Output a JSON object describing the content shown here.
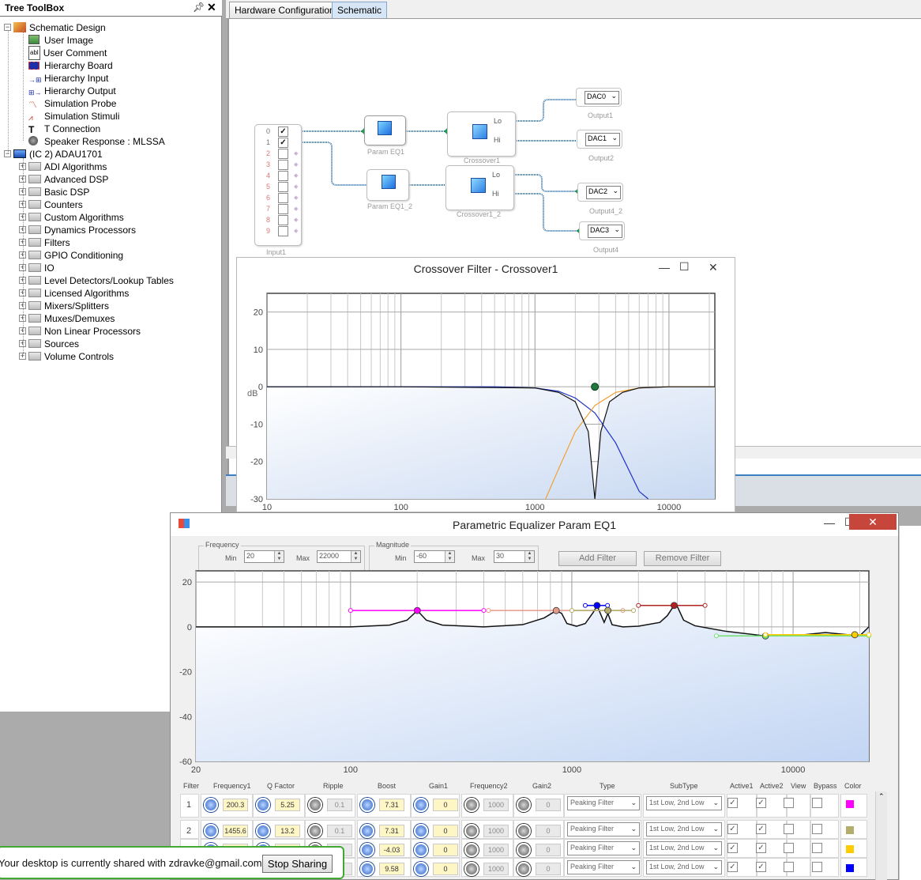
{
  "tree": {
    "title": "Tree ToolBox",
    "items": [
      {
        "label": "Schematic Design",
        "level": 0,
        "expanded": true,
        "icon": "schematic-icon"
      },
      {
        "label": "User Image",
        "level": 1,
        "icon": "image-icon"
      },
      {
        "label": "User Comment",
        "level": 1,
        "icon": "text-icon",
        "glyph": "abl"
      },
      {
        "label": "Hierarchy Board",
        "level": 1,
        "icon": "board-icon"
      },
      {
        "label": "Hierarchy Input",
        "level": 1,
        "icon": "input-icon"
      },
      {
        "label": "Hierarchy Output",
        "level": 1,
        "icon": "output-icon"
      },
      {
        "label": "Simulation Probe",
        "level": 1,
        "icon": "probe-icon"
      },
      {
        "label": "Simulation Stimuli",
        "level": 1,
        "icon": "stimuli-icon"
      },
      {
        "label": "T Connection",
        "level": 1,
        "icon": "t-connection-icon"
      },
      {
        "label": "Speaker Response : MLSSA",
        "level": 1,
        "icon": "speaker-icon"
      },
      {
        "label": "(IC 2) ADAU1701",
        "level": 0,
        "expanded": true,
        "icon": "chip-icon"
      },
      {
        "label": "ADI Algorithms",
        "level": 1,
        "icon": "folder-icon"
      },
      {
        "label": "Advanced DSP",
        "level": 1,
        "icon": "folder-icon"
      },
      {
        "label": "Basic DSP",
        "level": 1,
        "icon": "folder-icon"
      },
      {
        "label": "Counters",
        "level": 1,
        "icon": "folder-icon"
      },
      {
        "label": "Custom Algorithms",
        "level": 1,
        "icon": "folder-icon"
      },
      {
        "label": "Dynamics Processors",
        "level": 1,
        "icon": "folder-icon"
      },
      {
        "label": "Filters",
        "level": 1,
        "icon": "folder-icon"
      },
      {
        "label": "GPIO Conditioning",
        "level": 1,
        "icon": "folder-icon"
      },
      {
        "label": "IO",
        "level": 1,
        "icon": "folder-icon"
      },
      {
        "label": "Level Detectors/Lookup Tables",
        "level": 1,
        "icon": "folder-icon"
      },
      {
        "label": "Licensed Algorithms",
        "level": 1,
        "icon": "folder-icon"
      },
      {
        "label": "Mixers/Splitters",
        "level": 1,
        "icon": "folder-icon"
      },
      {
        "label": "Muxes/Demuxes",
        "level": 1,
        "icon": "folder-icon"
      },
      {
        "label": "Non Linear Processors",
        "level": 1,
        "icon": "folder-icon"
      },
      {
        "label": "Sources",
        "level": 1,
        "icon": "folder-icon"
      },
      {
        "label": "Volume Controls",
        "level": 1,
        "icon": "folder-icon"
      }
    ]
  },
  "tabs": [
    {
      "label": "Hardware Configuration",
      "active": false
    },
    {
      "label": "Schematic",
      "active": true
    }
  ],
  "schematic": {
    "input_label": "Input1",
    "input_channels": [
      "0",
      "1",
      "2",
      "3",
      "4",
      "5",
      "6",
      "7",
      "8",
      "9"
    ],
    "input_checked": [
      true,
      true,
      false,
      false,
      false,
      false,
      false,
      false,
      false,
      false
    ],
    "blocks": {
      "eq1": "Param EQ1",
      "eq1_2": "Param EQ1_2",
      "xo1": "Crossover1",
      "xo1_2": "Crossover1_2",
      "lo": "Lo",
      "hi": "Hi"
    },
    "outputs": [
      {
        "dac": "DAC0",
        "label": "Output1"
      },
      {
        "dac": "DAC1",
        "label": "Output2"
      },
      {
        "dac": "DAC2",
        "label": "Output4_2"
      },
      {
        "dac": "DAC3",
        "label": "Output4"
      }
    ]
  },
  "crossover_window": {
    "title": "Crossover Filter - Crossover1",
    "minimize": "—",
    "maximize": "☐",
    "close": "✕"
  },
  "eq_window": {
    "title": "Parametric Equalizer Param EQ1",
    "minimize": "—",
    "maximize": "☐",
    "close": "✕",
    "frequency_group": {
      "legend": "Frequency",
      "min_label": "Min",
      "min": "20",
      "max_label": "Max",
      "max": "22000"
    },
    "magnitude_group": {
      "legend": "Magnitude",
      "min_label": "Min",
      "min": "-60",
      "max_label": "Max",
      "max": "30"
    },
    "add_filter": "Add Filter",
    "remove_filter": "Remove Filter",
    "table": {
      "headers": [
        "Filter",
        "Frequency1",
        "Q Factor",
        "Ripple",
        "Boost",
        "Gain1",
        "Frequency2",
        "Gain2",
        "Type",
        "SubType",
        "Active1",
        "Active2",
        "View",
        "Bypass",
        "Color"
      ],
      "rows": [
        {
          "filter": "1",
          "frequency1": "200.3",
          "q": "5.25",
          "ripple": "0.1",
          "boost": "7.31",
          "gain1": "0",
          "frequency2": "1000",
          "gain2": "0",
          "type": "Peaking Filter",
          "subtype": "1st Low, 2nd Low",
          "active1": true,
          "active2": true,
          "view": false,
          "bypass": false,
          "color": "#ff00ff"
        },
        {
          "filter": "2",
          "frequency1": "1455.6",
          "q": "13.2",
          "ripple": "0.1",
          "boost": "7.31",
          "gain1": "0",
          "frequency2": "1000",
          "gain2": "0",
          "type": "Peaking Filter",
          "subtype": "1st Low, 2nd Low",
          "active1": true,
          "active2": true,
          "view": false,
          "bypass": false,
          "color": "#b5ad6b"
        },
        {
          "filter": "",
          "frequency1": "",
          "q": "",
          "ripple": "",
          "boost": "-4.03",
          "gain1": "0",
          "frequency2": "1000",
          "gain2": "0",
          "type": "Peaking Filter",
          "subtype": "1st Low, 2nd Low",
          "active1": true,
          "active2": true,
          "view": false,
          "bypass": false,
          "color": "#ffcc00"
        },
        {
          "filter": "",
          "frequency1": "",
          "q": "",
          "ripple": "",
          "boost": "9.58",
          "gain1": "0",
          "frequency2": "1000",
          "gain2": "0",
          "type": "Peaking Filter",
          "subtype": "1st Low, 2nd Low",
          "active1": true,
          "active2": true,
          "view": false,
          "bypass": false,
          "color": "#0000ff"
        }
      ]
    }
  },
  "share_banner": {
    "message": "Your desktop is currently shared with zdravke@gmail.com.",
    "stop_button": "Stop Sharing"
  },
  "colors": {
    "accent": "#3b7fc1",
    "share_border": "#41a832",
    "close_red": "#c7463c",
    "plot_fill": "#dde8f7",
    "lowpass": "#1f33c8",
    "highpass": "#f0a030",
    "sum": "#111111"
  },
  "chart_data": [
    {
      "type": "line",
      "title": "",
      "xlabel": "",
      "ylabel": "dB",
      "xscale": "log",
      "xlim": [
        10,
        22000
      ],
      "ylim": [
        -30,
        25
      ],
      "xticks": [
        "10",
        "100",
        "1000",
        "10000"
      ],
      "yticks": [
        "20",
        "10",
        "0",
        "-10",
        "-20",
        "-30"
      ],
      "grid": true,
      "crossover_frequency": 2800,
      "crossover_point_db": 0,
      "series": [
        {
          "role": "lowpass",
          "x": [
            10,
            100,
            500,
            1000,
            1500,
            2000,
            2800,
            4000,
            6000,
            7000
          ],
          "y": [
            0,
            0,
            0,
            -0.3,
            -1.2,
            -3,
            -7,
            -15,
            -28,
            -30
          ]
        },
        {
          "role": "highpass",
          "x": [
            1200,
            1500,
            2000,
            2800,
            4000,
            6000,
            10000,
            22000
          ],
          "y": [
            -30,
            -22,
            -12,
            -5,
            -1.5,
            -0.3,
            0,
            0
          ]
        },
        {
          "role": "sum",
          "x": [
            10,
            100,
            1000,
            1500,
            2000,
            2500,
            2800,
            3100,
            3600,
            4500,
            6000,
            10000,
            22000
          ],
          "y": [
            0,
            0,
            -0.3,
            -1.5,
            -4,
            -12,
            -30,
            -12,
            -4,
            -1.5,
            -0.3,
            0,
            0
          ]
        }
      ]
    },
    {
      "type": "line",
      "title": "",
      "xlabel": "",
      "ylabel": "",
      "xscale": "log",
      "xlim": [
        20,
        22000
      ],
      "ylim": [
        -60,
        25
      ],
      "xticks": [
        "20",
        "100",
        "1000",
        "10000"
      ],
      "yticks": [
        "20",
        "0",
        "-20",
        "-40",
        "-60"
      ],
      "grid": true,
      "series": [
        {
          "role": "response",
          "x": [
            20,
            100,
            150,
            180,
            200.3,
            220,
            260,
            400,
            600,
            750,
            850,
            900,
            950,
            1050,
            1150,
            1250,
            1300,
            1400,
            1455.6,
            1520,
            1700,
            2000,
            2500,
            2700,
            2900,
            3000,
            3200,
            3600,
            5000,
            7500,
            10000,
            14000,
            20000,
            22000
          ],
          "y": [
            0,
            0,
            0.8,
            3,
            7.31,
            3,
            0.8,
            0,
            1,
            4,
            7.3,
            6,
            1.5,
            0.3,
            1.5,
            6.5,
            9.5,
            2,
            6,
            1,
            0,
            0.3,
            2,
            5,
            9.58,
            9,
            3,
            0.5,
            -2,
            -4.03,
            -4,
            -2.5,
            -4,
            0
          ]
        }
      ],
      "handles": [
        {
          "x": 200.3,
          "y": 7.31,
          "color": "#ff00ff",
          "range": [
            100,
            400
          ]
        },
        {
          "x": 850,
          "y": 7.3,
          "color": "#e69a8a",
          "range": [
            420,
            1700
          ]
        },
        {
          "x": 1300,
          "y": 9.58,
          "color": "#0000ff",
          "range": [
            1150,
            1450
          ]
        },
        {
          "x": 1455.6,
          "y": 7.31,
          "color": "#b5ad6b",
          "range": [
            1000,
            1900
          ]
        },
        {
          "x": 2900,
          "y": 9.58,
          "color": "#b22222",
          "range": [
            2000,
            4000
          ]
        },
        {
          "x": 7500,
          "y": -4.03,
          "color": "#70e070",
          "range": [
            4500,
            22000
          ]
        },
        {
          "x": 19000,
          "y": -3.5,
          "color": "#ffcc00",
          "range": [
            7500,
            22000
          ]
        }
      ]
    }
  ]
}
